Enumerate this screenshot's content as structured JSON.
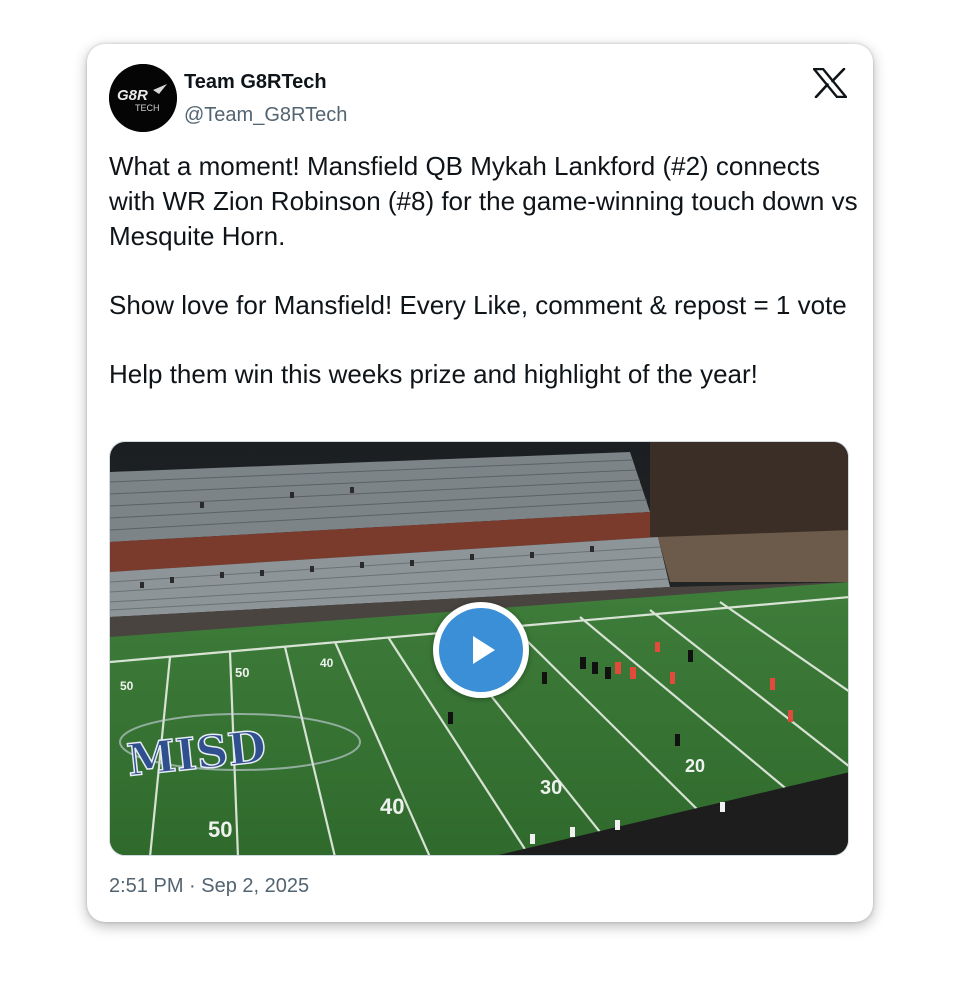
{
  "author": {
    "display_name": "Team G8RTech",
    "handle": "@Team_G8RTech",
    "avatar_text_top": "G8R",
    "avatar_text_bottom": "TECH"
  },
  "tweet": {
    "paragraphs": [
      "What a moment! Mansfield QB Mykah Lankford (#2) connects with WR Zion Robinson (#8) for the game-winning touch down vs Mesquite Horn.",
      "Show love for Mansfield! Every Like, comment & repost = 1 vote",
      "Help them win this weeks prize and highlight of the year!"
    ],
    "timestamp": "2:51 PM · Sep 2, 2025"
  },
  "media": {
    "type": "video",
    "field_logo_text": "MISD",
    "yard_numbers": [
      "50",
      "40",
      "30",
      "20",
      "50",
      "40",
      "50"
    ],
    "icons": {
      "play": "play-icon",
      "brand": "x-logo-icon"
    }
  },
  "colors": {
    "text_primary": "#0f1419",
    "text_secondary": "#536471",
    "play_accent": "#3a8fd6",
    "field_green": "#3e7a3a"
  }
}
